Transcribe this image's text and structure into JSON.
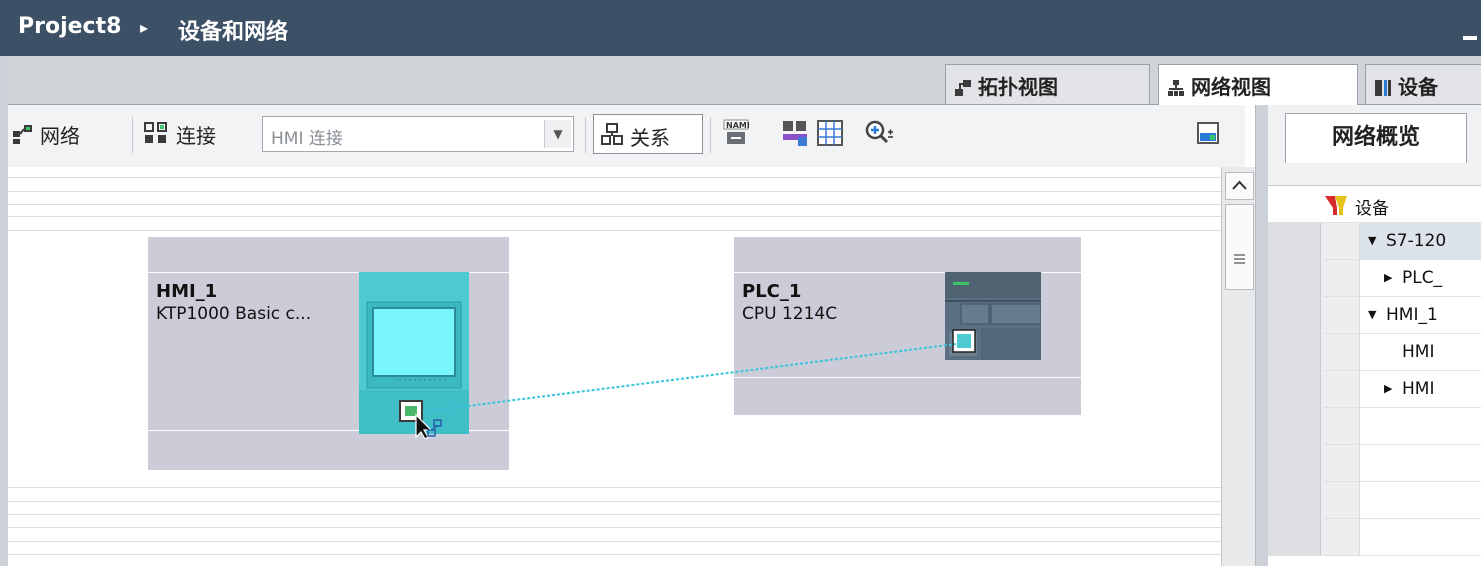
{
  "window": {
    "project": "Project8",
    "breadcrumb_sep": "▸",
    "page_title": "设备和网络"
  },
  "view_tabs": [
    {
      "label": "拓扑视图",
      "icon": "topology-view-icon"
    },
    {
      "label": "网络视图",
      "icon": "network-view-icon",
      "active": true
    },
    {
      "label": "设备",
      "icon": "device-view-icon"
    }
  ],
  "toolbar": {
    "network_label": "网络",
    "connect_label": "连接",
    "connection_type": "HMI 连接",
    "relations_label": "关系"
  },
  "devices": [
    {
      "name": "HMI_1",
      "type": "KTP1000 Basic c..."
    },
    {
      "name": "PLC_1",
      "type": "CPU 1214C"
    }
  ],
  "overview": {
    "tab_label": "网络概览",
    "column_header": "设备",
    "rows": [
      {
        "label": "S7-120",
        "expander": "down"
      },
      {
        "label": "PLC_",
        "expander": "right"
      },
      {
        "label": "HMI_1",
        "expander": "down"
      },
      {
        "label": "HMI",
        "expander": "none"
      },
      {
        "label": "HMI",
        "expander": "right"
      }
    ]
  },
  "colors": {
    "title_bar": "#3c5066",
    "device_box": "#cbccd7",
    "hmi_teal": "#4dc9d2",
    "connection_line": "#39c4dc"
  }
}
